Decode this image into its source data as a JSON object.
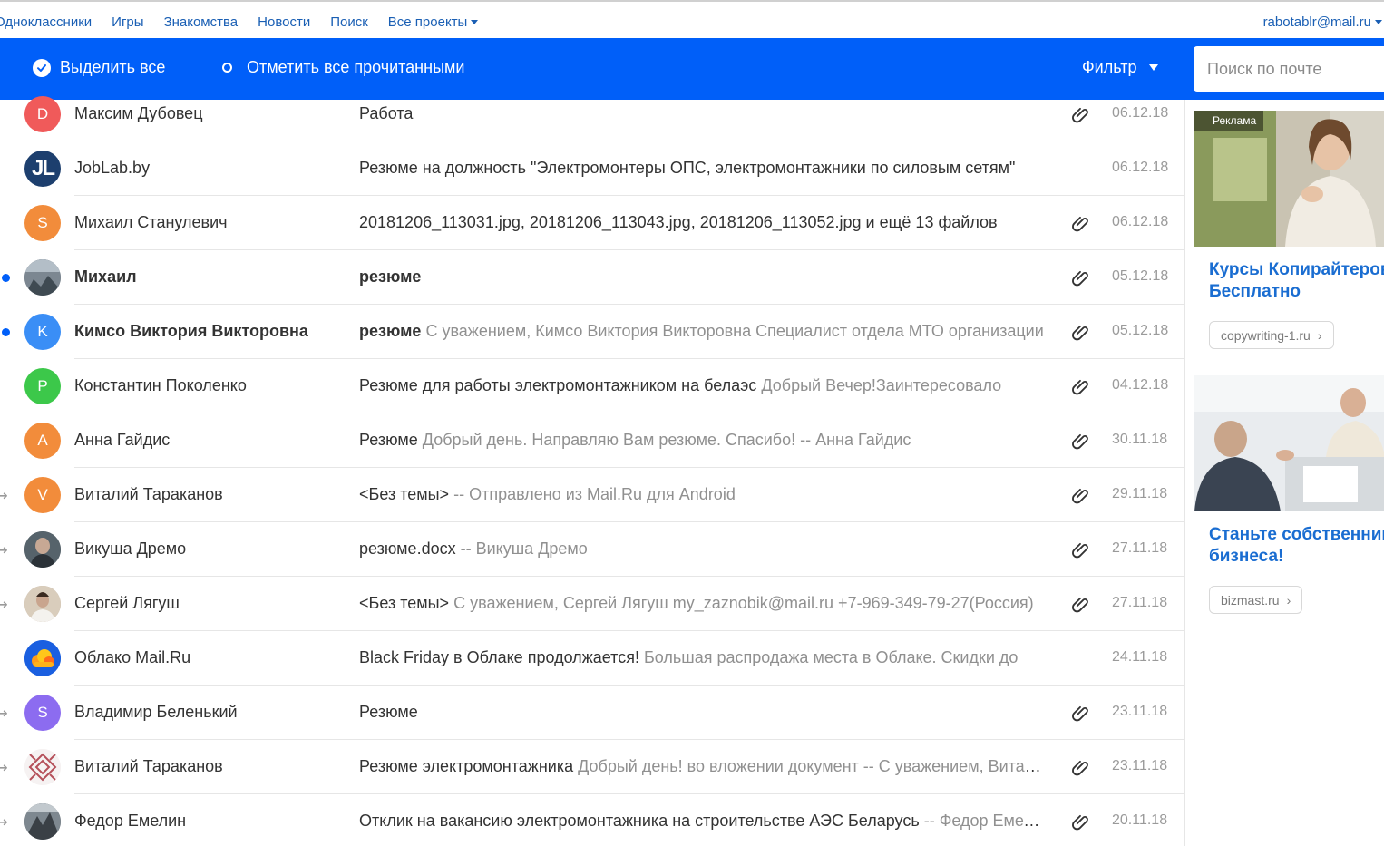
{
  "topnav": {
    "links": [
      "Одноклассники",
      "Игры",
      "Знакомства",
      "Новости",
      "Поиск"
    ],
    "more": "Все проекты",
    "user": "rabotablr@mail.ru"
  },
  "toolbar": {
    "select_all": "Выделить все",
    "mark_read": "Отметить все прочитанными",
    "filter": "Фильтр",
    "search_placeholder": "Поиск по почте"
  },
  "colors": {
    "accent": "#005ff9",
    "link": "#1a6dd1"
  },
  "emails": [
    {
      "sender": "Максим Дубовец",
      "subject": "Работа",
      "snippet": "",
      "date": "06.12.18",
      "attachment": true,
      "unread": false,
      "forwarded": false,
      "avatar": {
        "letter": "D",
        "color": "#f05a5a"
      }
    },
    {
      "sender": "JobLab.by",
      "subject": "Резюме на должность \"Электромонтеры ОПС, электромонтажники по силовым сетям\"",
      "snippet": "",
      "date": "06.12.18",
      "attachment": false,
      "unread": false,
      "forwarded": false,
      "avatar": {
        "letter": "JL",
        "color": "#1d3f6e"
      }
    },
    {
      "sender": "Михаил Станулевич",
      "subject": "20181206_113031.jpg, 20181206_113043.jpg, 20181206_113052.jpg и ещё 13 файлов",
      "snippet": "",
      "date": "06.12.18",
      "attachment": true,
      "unread": false,
      "forwarded": false,
      "avatar": {
        "letter": "S",
        "color": "#f28c3b"
      }
    },
    {
      "sender": "Михаил",
      "subject": "резюме",
      "snippet": "",
      "date": "05.12.18",
      "attachment": true,
      "unread": true,
      "forwarded": false,
      "avatar": {
        "letter": "",
        "color": "#5a6470"
      }
    },
    {
      "sender": "Кимсо Виктория Викторовна",
      "subject": "резюме",
      "snippet": "С уважением, Кимсо Виктория Викторовна Специалист отдела МТО организации",
      "date": "05.12.18",
      "attachment": true,
      "unread": true,
      "forwarded": false,
      "avatar": {
        "letter": "K",
        "color": "#3a8ef6"
      }
    },
    {
      "sender": "Константин Поколенко",
      "subject": "Резюме для работы электромонтажником на белаэс",
      "snippet": "Добрый Вечер!Заинтересовало",
      "date": "04.12.18",
      "attachment": true,
      "unread": false,
      "forwarded": false,
      "avatar": {
        "letter": "P",
        "color": "#3cc84a"
      }
    },
    {
      "sender": "Анна Гайдис",
      "subject": "Резюме",
      "snippet": "Добрый день. Направляю Вам резюме. Спасибо! -- Анна Гайдис",
      "date": "30.11.18",
      "attachment": true,
      "unread": false,
      "forwarded": false,
      "avatar": {
        "letter": "A",
        "color": "#f28c3b"
      }
    },
    {
      "sender": "Виталий Тараканов",
      "subject": "<Без темы>",
      "snippet": "-- Отправлено из Mail.Ru для Android",
      "date": "29.11.18",
      "attachment": true,
      "unread": false,
      "forwarded": true,
      "avatar": {
        "letter": "V",
        "color": "#f28c3b"
      }
    },
    {
      "sender": "Викуша Дремо",
      "subject": "резюме.docx",
      "snippet": "-- Викуша Дремо",
      "date": "27.11.18",
      "attachment": true,
      "unread": false,
      "forwarded": true,
      "avatar": {
        "letter": "",
        "color": "#3e4a52"
      }
    },
    {
      "sender": "Сергей Лягуш",
      "subject": "<Без темы>",
      "snippet": "С уважением, Сергей Лягуш my_zaznobik@mail.ru +7-969-349-79-27(Россия)",
      "date": "27.11.18",
      "attachment": true,
      "unread": false,
      "forwarded": true,
      "avatar": {
        "letter": "",
        "color": "#b8a48e"
      }
    },
    {
      "sender": "Облако Mail.Ru",
      "subject": "Black Friday в Облаке продолжается!",
      "snippet": "Большая распродажа места в Облаке. Скидки до",
      "date": "24.11.18",
      "attachment": false,
      "unread": false,
      "forwarded": false,
      "avatar": {
        "letter": "",
        "color": "#1a5fe0"
      }
    },
    {
      "sender": "Владимир Беленький",
      "subject": "Резюме",
      "snippet": "",
      "date": "23.11.18",
      "attachment": true,
      "unread": false,
      "forwarded": true,
      "avatar": {
        "letter": "S",
        "color": "#8c6cf0"
      }
    },
    {
      "sender": "Виталий Тараканов",
      "subject": "Резюме электромонтажника",
      "snippet": "Добрый день! во вложении документ -- С уважением, Виталий",
      "date": "23.11.18",
      "attachment": true,
      "unread": false,
      "forwarded": true,
      "avatar": {
        "letter": "",
        "color": "#f4f0f0"
      }
    },
    {
      "sender": "Федор Емелин",
      "subject": "Отклик на вакансию электромонтажника на строительстве АЭС Беларусь",
      "snippet": "-- Федор Емелин",
      "date": "20.11.18",
      "attachment": true,
      "unread": false,
      "forwarded": true,
      "avatar": {
        "letter": "",
        "color": "#4a4f55"
      }
    }
  ],
  "ads": [
    {
      "label": "Реклама",
      "title_line1": "Курсы Копирайтеров",
      "title_line2": "Бесплатно",
      "domain": "copywriting-1.ru"
    },
    {
      "label": "",
      "title_line1": "Станьте собственником",
      "title_line2": "бизнеса!",
      "domain": "bizmast.ru"
    }
  ]
}
